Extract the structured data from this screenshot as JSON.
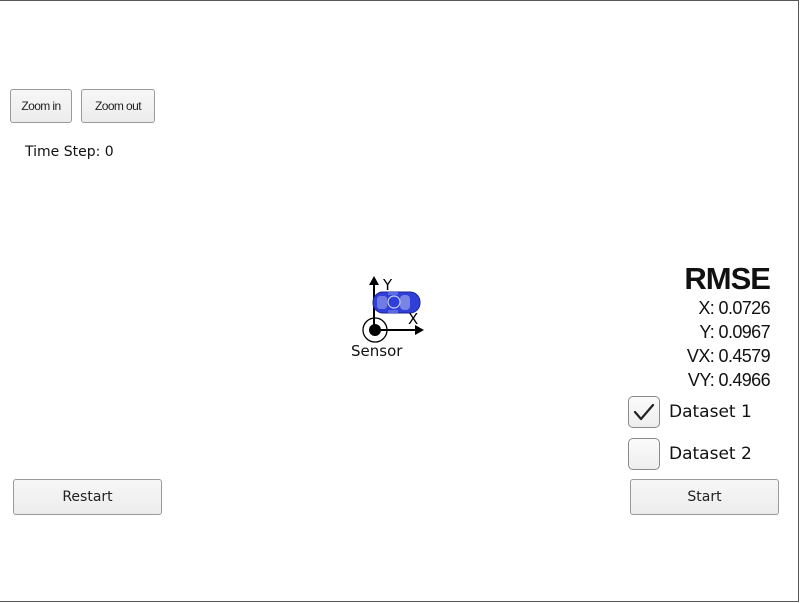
{
  "toolbar": {
    "zoom_in_label": "Zoom in",
    "zoom_out_label": "Zoom out"
  },
  "status": {
    "time_step_label": "Time Step: 0"
  },
  "rmse": {
    "title": "RMSE",
    "x": "X: 0.0726",
    "y": "Y: 0.0967",
    "vx": "VX: 0.4579",
    "vy": "VY: 0.4966"
  },
  "datasets": [
    {
      "label": "Dataset 1",
      "checked": true
    },
    {
      "label": "Dataset 2",
      "checked": false
    }
  ],
  "controls": {
    "restart_label": "Restart",
    "start_label": "Start"
  },
  "simulation": {
    "axis_x_label": "X",
    "axis_y_label": "Y",
    "sensor_label": "Sensor",
    "car_color": "#2f3fd8",
    "car_icon": "car-icon"
  }
}
